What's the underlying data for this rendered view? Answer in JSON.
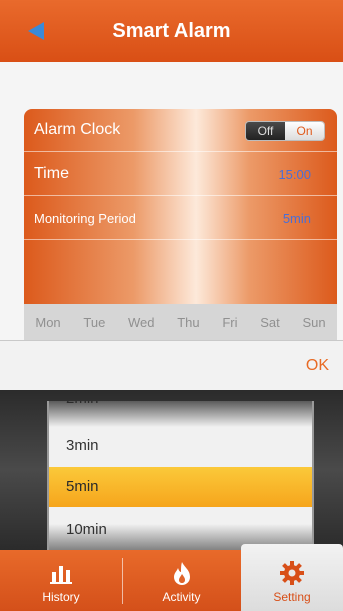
{
  "header": {
    "title": "Smart Alarm",
    "back_icon": "back-arrow-icon"
  },
  "settings": {
    "alarm_clock": {
      "label": "Alarm Clock",
      "toggle_off": "Off",
      "toggle_on": "On"
    },
    "time": {
      "label": "Time",
      "value": "15:00"
    },
    "monitoring_period": {
      "label": "Monitoring Period",
      "value": "5min"
    },
    "days": [
      "Mon",
      "Tue",
      "Wed",
      "Thu",
      "Fri",
      "Sat",
      "Sun"
    ]
  },
  "picker": {
    "ok_label": "OK",
    "options": [
      "2min",
      "3min",
      "5min",
      "10min"
    ],
    "selected": "5min"
  },
  "tabbar": {
    "items": [
      {
        "label": "History",
        "icon": "bar-chart-icon"
      },
      {
        "label": "Activity",
        "icon": "flame-icon"
      },
      {
        "label": "Setting",
        "icon": "gear-icon"
      }
    ],
    "active": "Setting"
  },
  "colors": {
    "accent": "#e05a1c",
    "picker_selected": "#f7b02a",
    "link_blue": "#4a6fd6"
  }
}
